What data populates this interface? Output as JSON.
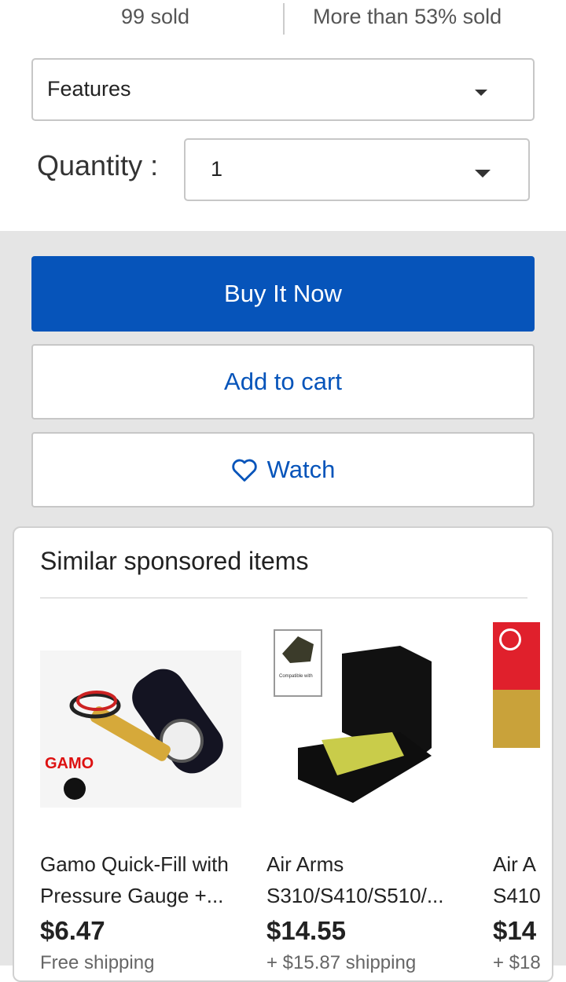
{
  "stats": {
    "sold": "99 sold",
    "percent_sold": "More than 53% sold"
  },
  "variation": {
    "label": "Features",
    "icon": "chevron-down-icon"
  },
  "quantity": {
    "label": "Quantity :",
    "value": "1"
  },
  "actions": {
    "buy_now": "Buy It Now",
    "add_to_cart": "Add to cart",
    "watch": "Watch",
    "watch_icon": "heart-icon"
  },
  "colors": {
    "accent": "#0654ba",
    "badge": "#e0202c"
  },
  "sponsored": {
    "title": "Similar sponsored items",
    "items": [
      {
        "title": "Gamo Quick-Fill with Pressure Gauge +...",
        "price": "$6.47",
        "shipping": "Free shipping",
        "logo": "GAMO"
      },
      {
        "title": "Air Arms S310/S410/S510/...",
        "price": "$14.55",
        "shipping": "+ $15.87 shipping",
        "label": "Compatible with"
      },
      {
        "title": "Air A S410",
        "price": "$14",
        "shipping": "+ $18",
        "badge_icon": "clock-icon"
      }
    ]
  }
}
